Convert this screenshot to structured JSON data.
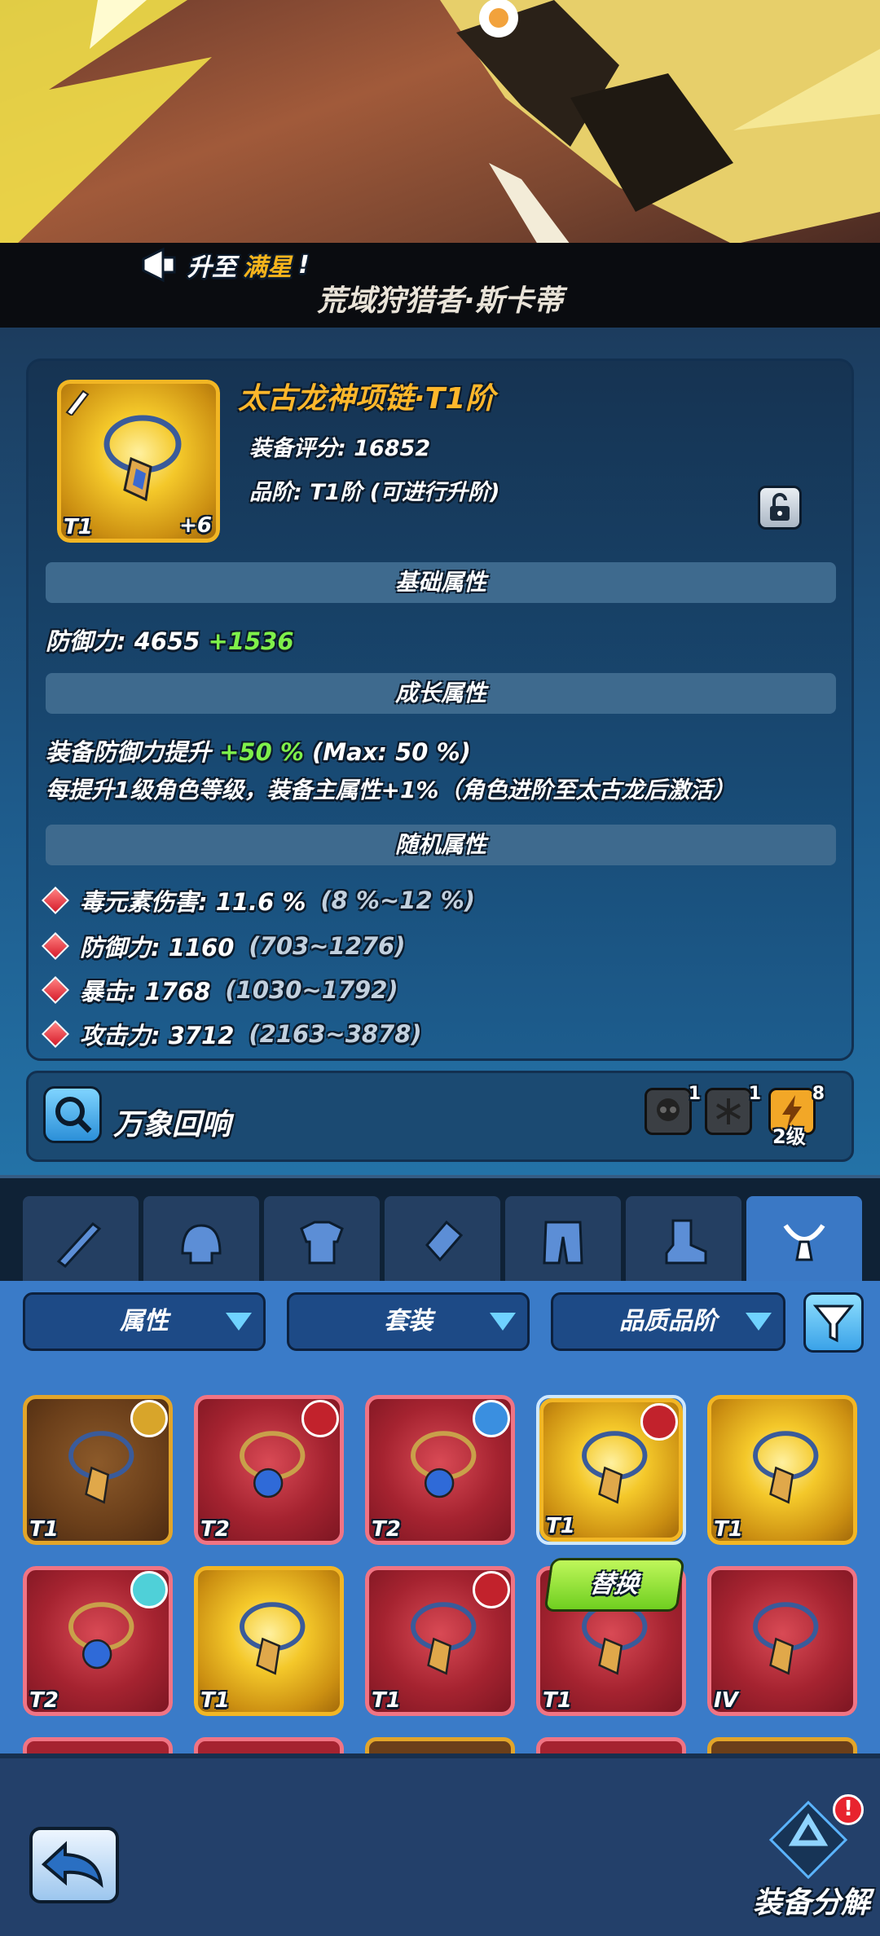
{
  "hero": {
    "announce_prefix": "升至",
    "announce_highlight": "满星",
    "announce_suffix": "!",
    "name": "荒域狩猎者·斯卡蒂"
  },
  "item": {
    "name": "太古龙神项链·T1阶",
    "score_label": "装备评分: 16852",
    "grade_label": "品阶: T1阶 (可进行升阶)",
    "tier": "T1",
    "plus": "+6"
  },
  "sections": {
    "base": "基础属性",
    "growth": "成长属性",
    "random": "随机属性"
  },
  "base_stat": {
    "label": "防御力: 4655",
    "bonus": "+1536"
  },
  "growth_stats": {
    "line1_prefix": "装备防御力提升",
    "line1_value": "+50 %",
    "line1_suffix": "(Max: 50 %)",
    "line2": "每提升1级角色等级，装备主属性+1%（角色进阶至太古龙后激活）"
  },
  "random_stats": [
    {
      "label": "毒元素伤害: 11.6 %",
      "range": "(8 %~12 %)"
    },
    {
      "label": "防御力: 1160",
      "range": "(703~1276)"
    },
    {
      "label": "暴击: 1768",
      "range": "(1030~1792)"
    },
    {
      "label": "攻击力: 3712",
      "range": "(2163~3878)"
    }
  ],
  "echo": {
    "label": "万象回响",
    "icon1_count": "1",
    "icon2_count": "1",
    "icon3_count": "8",
    "icon3_level": "2级"
  },
  "tabs": [
    "weapon-icon",
    "helmet-icon",
    "armor-icon",
    "glove-icon",
    "pants-icon",
    "boots-icon",
    "necklace-icon"
  ],
  "filters": {
    "attr": "属性",
    "set": "套装",
    "quality": "品质品阶"
  },
  "grid": [
    {
      "tier": "T1",
      "style": "brown"
    },
    {
      "tier": "T2",
      "style": "red"
    },
    {
      "tier": "T2",
      "style": "red"
    },
    {
      "tier": "T1",
      "style": "gold"
    },
    {
      "tier": "T1",
      "style": "gold"
    },
    {
      "tier": "T2",
      "style": "red"
    },
    {
      "tier": "T1",
      "style": "gold"
    },
    {
      "tier": "T1",
      "style": "red"
    },
    {
      "tier": "T1",
      "style": "red"
    },
    {
      "tier": "IV",
      "style": "red"
    }
  ],
  "replace_label": "替换",
  "bottom": {
    "salvage_label": "装备分解",
    "alert": "!"
  }
}
